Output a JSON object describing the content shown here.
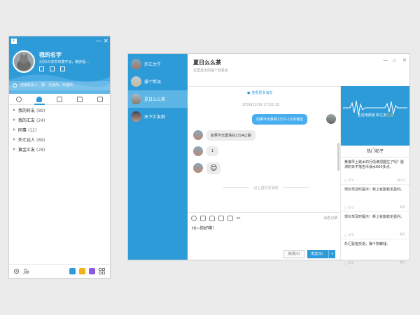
{
  "contacts_window": {
    "logo": "F",
    "username": "我的名字",
    "signature": "2月5日非农布德平淡，教养般...",
    "search_placeholder": "搜索联系人、群、交易商、代理商",
    "groups": [
      {
        "name": "我的好友",
        "count": "(89)"
      },
      {
        "name": "我的汇友",
        "count": "(24)"
      },
      {
        "name": "同事",
        "count": "(12)"
      },
      {
        "name": "外汇达人",
        "count": "(89)"
      },
      {
        "name": "黄金汇友",
        "count": "(28)"
      }
    ],
    "icons": [
      "settings-icon",
      "add-contact-icon",
      "calendar-icon",
      "badge-icon",
      "video-icon",
      "apps-icon"
    ]
  },
  "chat_window": {
    "sessions": [
      {
        "name": "外汇大牛",
        "selected": false
      },
      {
        "name": "操个帮派",
        "selected": false
      },
      {
        "name": "夏日么么茶",
        "selected": true
      },
      {
        "name": "天下汇友群",
        "selected": false
      }
    ],
    "title": "夏日么么茶",
    "subtitle": "这里显示的是个性签名",
    "more_messages": "查看更多消息",
    "timestamp": "2016/12/19   17:02:12",
    "messages": [
      {
        "from": "me",
        "text": "如果今天跌到1331-1330做空"
      },
      {
        "from": "them",
        "text": "如果今天震荡在1324止跌"
      },
      {
        "from": "them",
        "text": "1"
      },
      {
        "from": "them",
        "text": "😊"
      }
    ],
    "history_divider": "以上是历史消息",
    "history_link": "消息记录",
    "input_text": "Hi~你好啊！",
    "close_label": "关闭(C)",
    "send_label": "发送(S)",
    "banner_text_a": "生活用频道  职汇用",
    "banner_text_b": "汇信",
    "hot_title": "热门帖子",
    "posts": [
      {
        "title": "黄狼早上跳水的行情谁把握住了吗？胶涛的日不落告币涨水600多点。",
        "count": "475",
        "time": "08:23"
      },
      {
        "title": "现价单及时提示！新上就能稳定盈利。",
        "count": "475",
        "time": "昨天"
      },
      {
        "title": "现价单及时提示！新上就能稳定盈利。",
        "count": "475",
        "time": "昨天"
      },
      {
        "title": "外汇股指交易，赚个狗粮钱。",
        "count": "475",
        "time": "昨天"
      }
    ],
    "colors": {
      "accent": "#2e9bd9",
      "bubble_me": "#48aef0",
      "banner_highlight": "#ffd33a"
    }
  }
}
